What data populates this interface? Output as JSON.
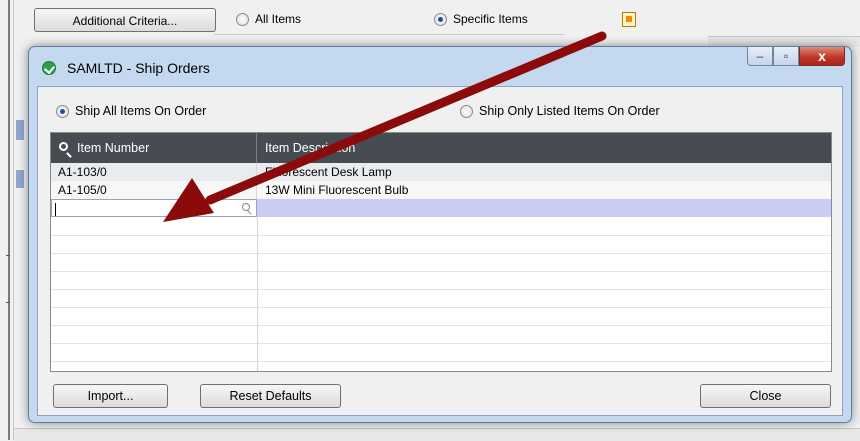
{
  "background": {
    "additional_criteria_label": "Additional Criteria...",
    "all_items_label": "All Items",
    "specific_items_label": "Specific Items"
  },
  "dialog": {
    "title": "SAMLTD - Ship Orders",
    "window_buttons": {
      "minimize": "–",
      "maximize": "▫",
      "close": "x"
    },
    "options": {
      "ship_all": "Ship All Items On Order",
      "ship_listed": "Ship Only Listed Items On Order",
      "selected": "ship_all"
    },
    "grid": {
      "columns": [
        "Item Number",
        "Item Description"
      ],
      "rows": [
        {
          "item_number": "A1-103/0",
          "description": "Fluorescent Desk Lamp"
        },
        {
          "item_number": "A1-105/0",
          "description": "13W Mini Fluorescent Bulb"
        }
      ],
      "edit_row_value": ""
    },
    "buttons": {
      "import": "Import...",
      "reset": "Reset Defaults",
      "close": "Close"
    }
  },
  "colors": {
    "header_bg": "#474b52",
    "edit_row_bg": "#cbcbf3",
    "arrow": "#8b0a0a",
    "dialog_frame": "#c4d8ef"
  }
}
